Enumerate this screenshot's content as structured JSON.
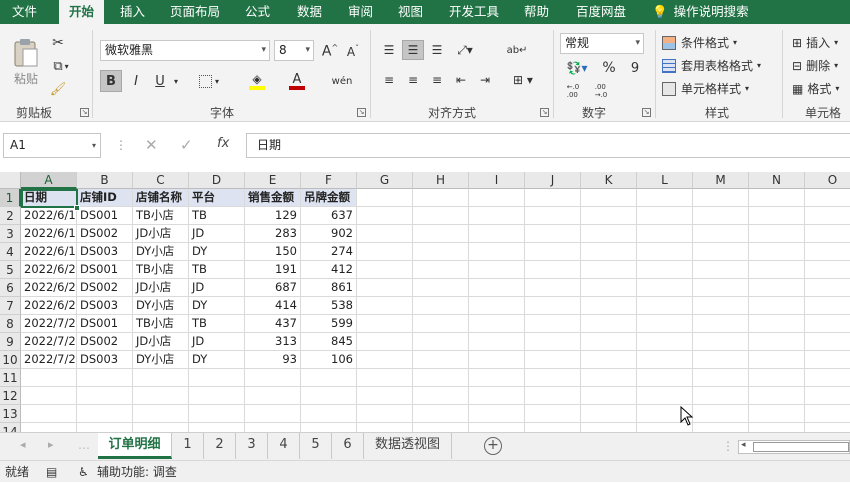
{
  "menu": {
    "items": [
      "文件",
      "开始",
      "插入",
      "页面布局",
      "公式",
      "数据",
      "审阅",
      "视图",
      "开发工具",
      "帮助",
      "百度网盘"
    ],
    "active_index": 1,
    "search_label": "操作说明搜索"
  },
  "ribbon": {
    "clipboard": {
      "paste_label": "粘贴",
      "group_label": "剪贴板"
    },
    "font": {
      "font_name": "微软雅黑",
      "font_size": "8",
      "bold": "B",
      "italic": "I",
      "underline": "U",
      "phonetic": "wén",
      "group_label": "字体"
    },
    "alignment": {
      "group_label": "对齐方式"
    },
    "number": {
      "format": "常规",
      "percent": "%",
      "comma": "9",
      "inc_decimal": "←.0\n.00",
      "dec_decimal": ".00\n→.0",
      "group_label": "数字"
    },
    "styles": {
      "conditional": "条件格式",
      "table_format": "套用表格格式",
      "cell_styles": "单元格样式",
      "group_label": "样式"
    },
    "cells": {
      "insert": "插入",
      "delete": "删除",
      "format": "格式",
      "group_label": "单元格"
    }
  },
  "formula_bar": {
    "name_box": "A1",
    "fx": "fx",
    "value": "日期"
  },
  "grid": {
    "columns": [
      "A",
      "B",
      "C",
      "D",
      "E",
      "F",
      "G",
      "H",
      "I",
      "J",
      "K",
      "L",
      "M",
      "N",
      "O"
    ],
    "row_numbers": [
      "1",
      "2",
      "3",
      "4",
      "5",
      "6",
      "7",
      "8",
      "9",
      "10",
      "11",
      "12",
      "13",
      "14"
    ],
    "header": [
      "日期",
      "店铺ID",
      "店铺名称",
      "平台",
      "销售金额",
      "吊牌金额"
    ],
    "rows": [
      [
        "2022/6/1",
        "DS001",
        "TB小店",
        "TB",
        "129",
        "637"
      ],
      [
        "2022/6/1",
        "DS002",
        "JD小店",
        "JD",
        "283",
        "902"
      ],
      [
        "2022/6/1",
        "DS003",
        "DY小店",
        "DY",
        "150",
        "274"
      ],
      [
        "2022/6/2",
        "DS001",
        "TB小店",
        "TB",
        "191",
        "412"
      ],
      [
        "2022/6/2",
        "DS002",
        "JD小店",
        "JD",
        "687",
        "861"
      ],
      [
        "2022/6/2",
        "DS003",
        "DY小店",
        "DY",
        "414",
        "538"
      ],
      [
        "2022/7/2",
        "DS001",
        "TB小店",
        "TB",
        "437",
        "599"
      ],
      [
        "2022/7/2",
        "DS002",
        "JD小店",
        "JD",
        "313",
        "845"
      ],
      [
        "2022/7/2",
        "DS003",
        "DY小店",
        "DY",
        "93",
        "106"
      ]
    ]
  },
  "sheets": {
    "tabs": [
      "订单明细",
      "1",
      "2",
      "3",
      "4",
      "5",
      "6",
      "数据透视图"
    ],
    "active_index": 0,
    "add": "+"
  },
  "status": {
    "ready": "就绪",
    "accessibility": "辅助功能: 调查"
  },
  "colors": {
    "brand": "#217346",
    "header_fill": "#dde3f0"
  }
}
